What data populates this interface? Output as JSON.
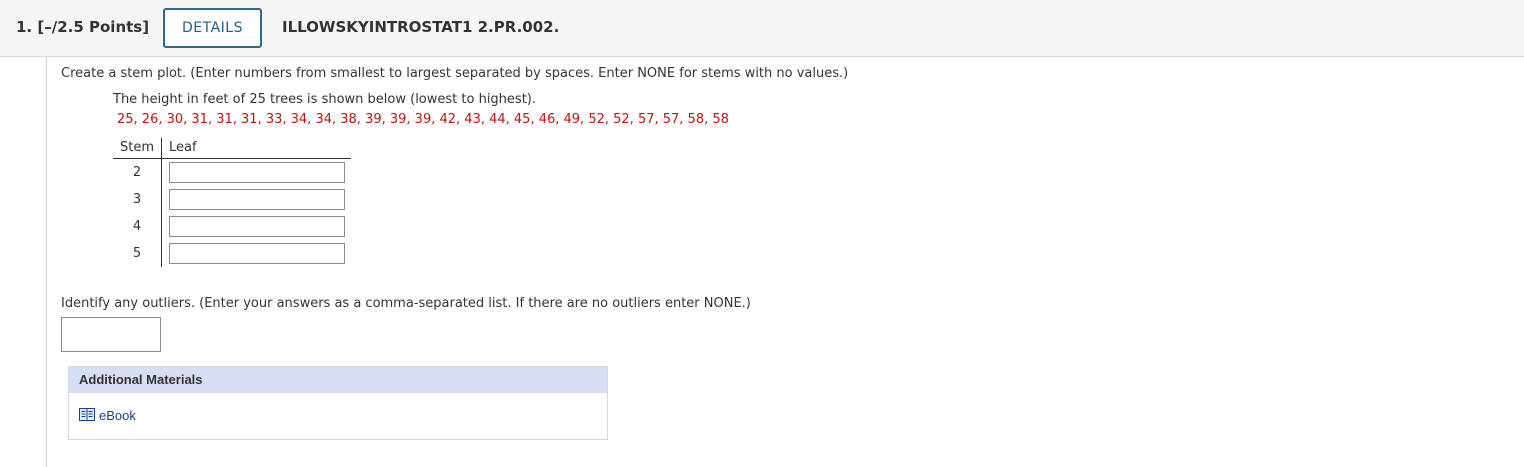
{
  "header": {
    "question_number": "1.",
    "points": "[–/2.5 Points]",
    "details_label": "DETAILS",
    "question_id": "ILLOWSKYINTROSTAT1 2.PR.002."
  },
  "question": {
    "instruction": "Create a stem plot. (Enter numbers from smallest to largest separated by spaces. Enter NONE for stems with no values.)",
    "prompt": "The height in feet of 25 trees is shown below (lowest to highest).",
    "data": "25, 26, 30, 31, 31, 31, 33, 34, 34, 38, 39, 39, 39, 42, 43, 44, 45, 46, 49, 52, 52, 57, 57, 58, 58"
  },
  "stem_plot": {
    "stem_header": "Stem",
    "leaf_header": "Leaf",
    "rows": [
      {
        "stem": "2",
        "leaf_value": ""
      },
      {
        "stem": "3",
        "leaf_value": ""
      },
      {
        "stem": "4",
        "leaf_value": ""
      },
      {
        "stem": "5",
        "leaf_value": ""
      }
    ]
  },
  "outliers": {
    "instruction": "Identify any outliers. (Enter your answers as a comma-separated list. If there are no outliers enter NONE.)",
    "value": ""
  },
  "additional_materials": {
    "title": "Additional Materials",
    "ebook_label": "eBook",
    "ebook_icon": "book-icon"
  },
  "colors": {
    "data_red": "#c0120f",
    "details_border": "#2b6b8f",
    "materials_header_bg": "#d6ddf5",
    "link_blue": "#1a3d8f"
  }
}
